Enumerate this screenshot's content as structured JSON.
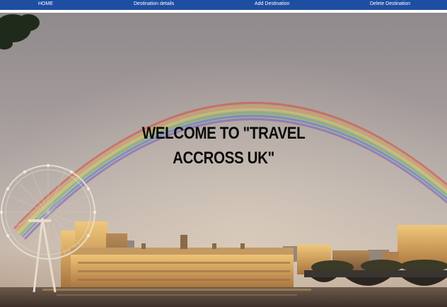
{
  "nav": {
    "items": [
      {
        "label": "HOME"
      },
      {
        "label": "Destination details"
      },
      {
        "label": "Add Destination"
      },
      {
        "label": "Delete Destination"
      }
    ],
    "bar_color": "#1e4ea1"
  },
  "hero": {
    "title_line1": "WELCOME TO \"TRAVEL",
    "title_line2": "ACCROSS UK\"",
    "scene": "london-eye-rainbow-photo"
  }
}
